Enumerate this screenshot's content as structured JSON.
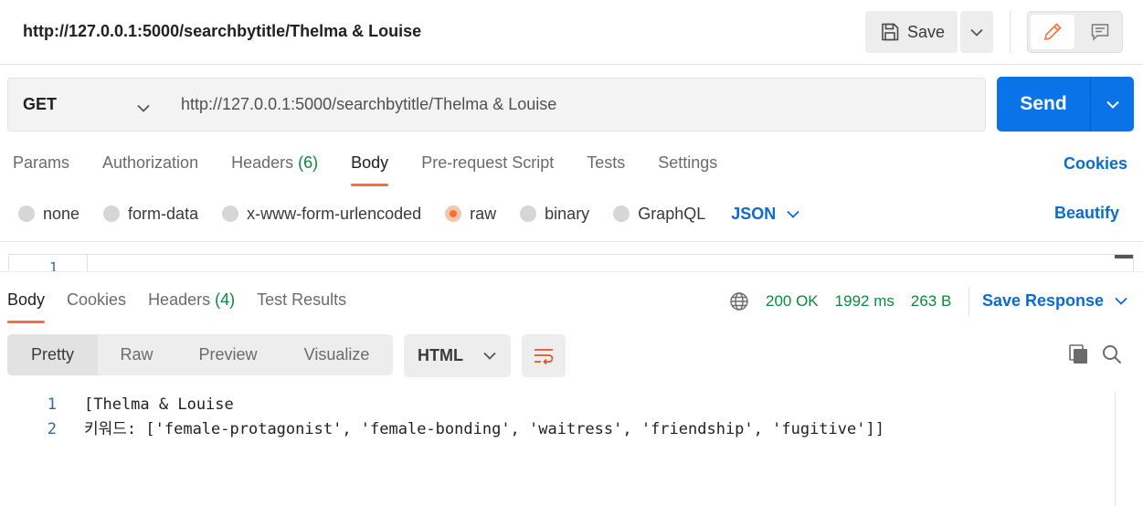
{
  "request_tab": {
    "title": "http://127.0.0.1:5000/searchbytitle/Thelma & Louise"
  },
  "header_actions": {
    "save_label": "Save"
  },
  "request": {
    "method": "GET",
    "url": "http://127.0.0.1:5000/searchbytitle/Thelma & Louise",
    "send_label": "Send"
  },
  "request_tabs": [
    {
      "label": "Params",
      "count": ""
    },
    {
      "label": "Authorization",
      "count": ""
    },
    {
      "label": "Headers",
      "count": "(6)"
    },
    {
      "label": "Body",
      "count": "",
      "active": true
    },
    {
      "label": "Pre-request Script",
      "count": ""
    },
    {
      "label": "Tests",
      "count": ""
    },
    {
      "label": "Settings",
      "count": ""
    }
  ],
  "cookies_link": "Cookies",
  "body_types": [
    {
      "label": "none",
      "selected": false
    },
    {
      "label": "form-data",
      "selected": false
    },
    {
      "label": "x-www-form-urlencoded",
      "selected": false
    },
    {
      "label": "raw",
      "selected": true
    },
    {
      "label": "binary",
      "selected": false
    },
    {
      "label": "GraphQL",
      "selected": false
    }
  ],
  "raw_language": "JSON",
  "beautify_label": "Beautify",
  "editor": {
    "line_number": "1"
  },
  "response_tabs": [
    {
      "label": "Body",
      "count": "",
      "active": true
    },
    {
      "label": "Cookies",
      "count": ""
    },
    {
      "label": "Headers",
      "count": "(4)"
    },
    {
      "label": "Test Results",
      "count": ""
    }
  ],
  "response_status": {
    "status": "200 OK",
    "time": "1992 ms",
    "size": "263 B"
  },
  "save_response_label": "Save Response",
  "view_modes": [
    "Pretty",
    "Raw",
    "Preview",
    "Visualize"
  ],
  "active_view_mode": "Pretty",
  "response_format": "HTML",
  "response_body": [
    {
      "line": "1",
      "text": "[Thelma & Louise"
    },
    {
      "line": "2",
      "text": "키워드: ['female-protagonist', 'female-bonding', 'waitress', 'friendship', 'fugitive']]"
    }
  ],
  "colors": {
    "accent": "#ff6c37",
    "primary_blue": "#0b73e8",
    "link_blue": "#0b6bd1",
    "success_green": "#0a8a3f"
  },
  "icons": [
    "save-icon",
    "chevron-down-icon",
    "pencil-icon",
    "comment-icon",
    "globe-icon",
    "wrap-lines-icon",
    "copy-icon",
    "search-icon"
  ]
}
